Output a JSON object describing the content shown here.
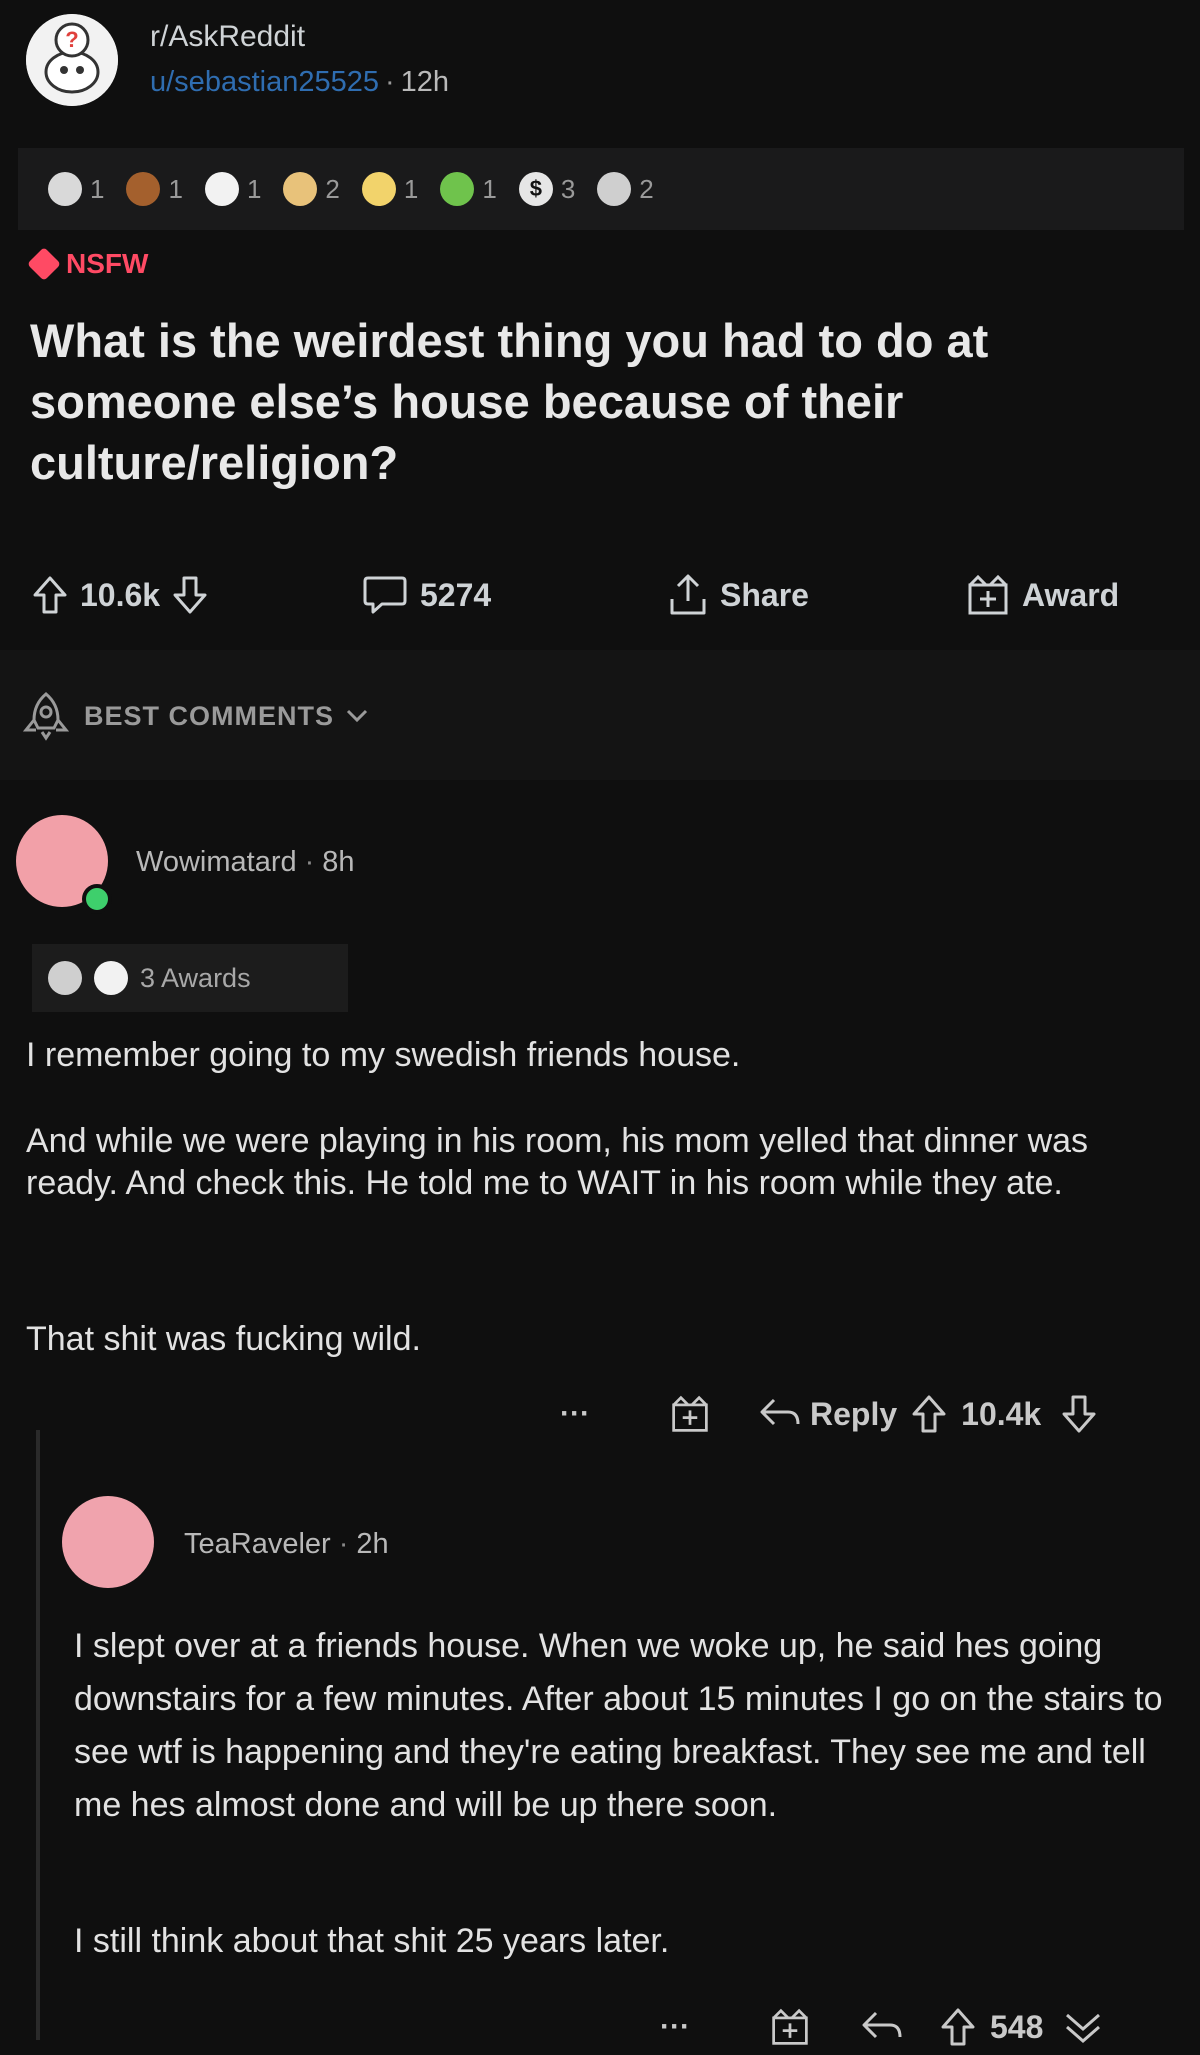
{
  "post": {
    "subreddit": "r/AskReddit",
    "username": "u/sebastian25525",
    "age": "12h",
    "awards": [
      {
        "icon": "silver-award-icon",
        "count": "1",
        "color": "#d9d9d9"
      },
      {
        "icon": "helpful-award-icon",
        "count": "1",
        "color": "#a4602d"
      },
      {
        "icon": "wholesome-award-icon",
        "count": "1",
        "color": "#f2f2f2"
      },
      {
        "icon": "heart-award-icon",
        "count": "2",
        "color": "#e8c27a"
      },
      {
        "icon": "party-award-icon",
        "count": "1",
        "color": "#f2d36b"
      },
      {
        "icon": "snek-award-icon",
        "count": "1",
        "color": "#6fc34c"
      },
      {
        "icon": "dollar-award-icon",
        "count": "3",
        "color": "#e6e6e6"
      },
      {
        "icon": "hug-award-icon",
        "count": "2",
        "color": "#cfcfcf"
      }
    ],
    "nsfw_label": "NSFW",
    "title": "What is the weirdest thing you had to do at someone else’s house because of their culture/religion?",
    "votes": "10.6k",
    "comments": "5274",
    "share_label": "Share",
    "award_label": "Award"
  },
  "sort": {
    "label": "BEST COMMENTS"
  },
  "comment1": {
    "username": "Wowimatard",
    "age": "8h",
    "awards_label": "3 Awards",
    "paragraphs": [
      "I remember going to my swedish friends house.",
      "And while we were playing in his room, his mom yelled that dinner was ready. And check this. He told me to WAIT in his room while they ate.",
      "That shit was fucking wild."
    ],
    "more": "···",
    "reply_label": "Reply",
    "votes": "10.4k"
  },
  "comment2": {
    "username": "TeaRaveler",
    "age": "2h",
    "paragraphs": [
      "I slept over at a friends house. When we woke up, he said hes going downstairs for a few minutes. After about 15 minutes I go on the stairs to see wtf is happening and they're eating breakfast. They see me and tell me hes almost done and will be up there soon.",
      "I still think about that shit 25 years later."
    ],
    "more": "···",
    "votes": "548"
  },
  "colors": {
    "accent_nsfw": "#ff4a64",
    "username_link": "#2f6db0",
    "online": "#3ecf6c"
  }
}
